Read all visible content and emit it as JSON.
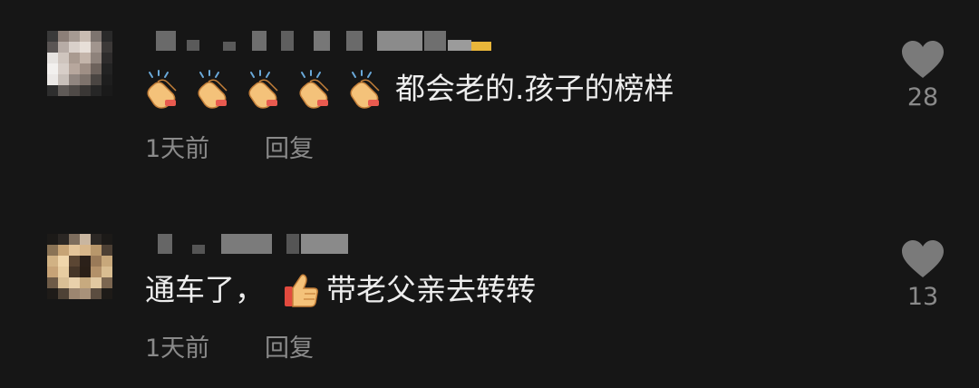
{
  "comments": [
    {
      "username": "",
      "text": "都会老的.孩子的榜样",
      "emoji_before": [
        "clapping-hands",
        "clapping-hands",
        "clapping-hands",
        "clapping-hands",
        "clapping-hands"
      ],
      "time": "1天前",
      "reply_label": "回复",
      "like_count": "28"
    },
    {
      "username": "",
      "text_before": "通车了，",
      "emoji_mid": "thumbs-up",
      "text_after": "带老父亲去转转",
      "time": "1天前",
      "reply_label": "回复",
      "like_count": "13"
    }
  ],
  "colors": {
    "background": "#161616",
    "text": "#ededed",
    "meta": "#8a8a8a",
    "heart": "#7a7a7a"
  },
  "icons": {
    "like": "heart-icon",
    "clap": "clapping-hands-icon",
    "thumb": "thumbs-up-icon"
  }
}
